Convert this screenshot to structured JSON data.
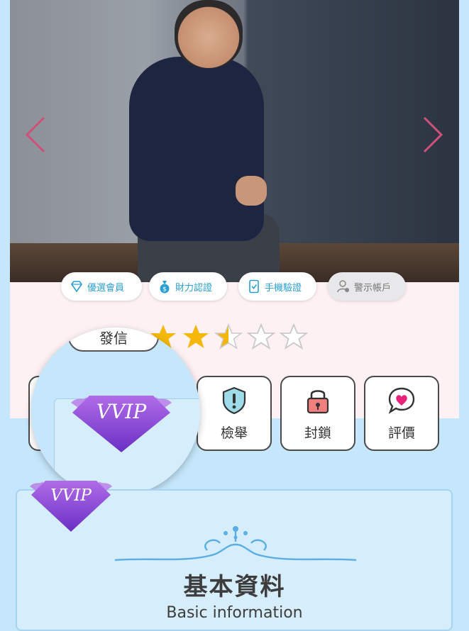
{
  "badges": [
    {
      "label": "優選會員",
      "icon": "diamond-icon"
    },
    {
      "label": "財力認證",
      "icon": "money-bag-icon"
    },
    {
      "label": "手機驗證",
      "icon": "phone-check-icon"
    },
    {
      "label": "警示帳戶",
      "icon": "user-alert-icon"
    }
  ],
  "message_button": {
    "label": "發信"
  },
  "rating": {
    "value": 2.5,
    "max": 5
  },
  "actions": [
    {
      "label": "檢舉",
      "icon": "shield-alert-icon"
    },
    {
      "label": "封鎖",
      "icon": "lock-icon"
    },
    {
      "label": "評價",
      "icon": "heart-chat-icon"
    }
  ],
  "vvip_label": "VVIP",
  "info_section": {
    "title": "基本資料",
    "subtitle": "Basic information"
  },
  "colors": {
    "accent_blue": "#2aa0d0",
    "nav_arrow": "#d0507a",
    "star": "#f5b80a",
    "vvip_purple": "#8a3fd6"
  }
}
